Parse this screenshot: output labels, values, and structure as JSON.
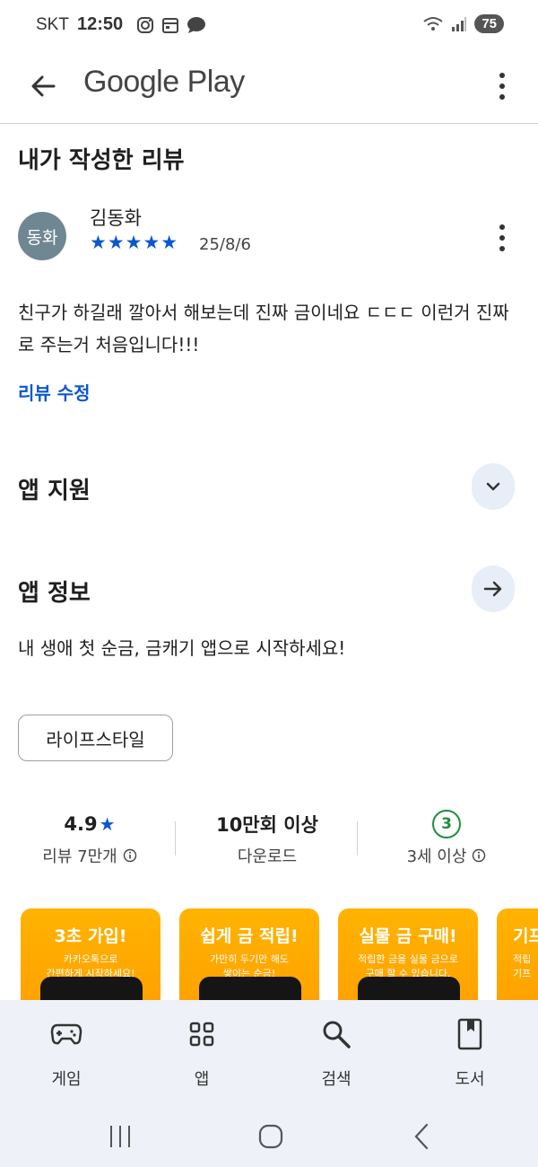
{
  "status_bar": {
    "carrier": "SKT",
    "time": "12:50",
    "battery": "75"
  },
  "app_bar": {
    "title": "Google Play"
  },
  "my_review": {
    "heading": "내가 작성한 리뷰",
    "avatar_text": "동화",
    "reviewer": "김동화",
    "stars": "★★★★★",
    "rating": 5,
    "date": "25/8/6",
    "text": "친구가 하길래 깔아서 해보는데 진짜 금이네요 ㄷㄷㄷ 이런거 진짜로 주는거 처음입니다!!!",
    "edit_label": "리뷰 수정"
  },
  "app_support": {
    "heading": "앱 지원"
  },
  "app_info": {
    "heading": "앱 정보",
    "description": "내 생애 첫 순금, 금캐기 앱으로 시작하세요!",
    "category": "라이프스타일"
  },
  "stats": {
    "rating_value": "4.9",
    "rating_star": "★",
    "rating_label": "리뷰 7만개",
    "downloads_value": "10만회 이상",
    "downloads_label": "다운로드",
    "age_value": "3",
    "age_label": "3세 이상"
  },
  "screenshots": [
    {
      "title": "3초 가입!",
      "subtitle": "카카오톡으로\n간편하게 시작하세요!"
    },
    {
      "title": "쉽게 금 적립!",
      "subtitle": "가만히 두기만 해도\n쌓이는 순금!"
    },
    {
      "title": "실물 금 구매!",
      "subtitle": "적립한 금을 실물 금으로\n구매 할 수 있습니다."
    },
    {
      "title": "기프",
      "subtitle": "적립\n기프"
    }
  ],
  "bottom_nav": [
    {
      "label": "게임",
      "icon": "gamepad-icon"
    },
    {
      "label": "앱",
      "icon": "apps-grid-icon"
    },
    {
      "label": "검색",
      "icon": "search-icon"
    },
    {
      "label": "도서",
      "icon": "book-icon"
    }
  ],
  "colors": {
    "accent": "#0b57d0",
    "star": "#0b57d0",
    "age_green": "#1e8e3e",
    "nav_bg": "#eef2f8"
  }
}
